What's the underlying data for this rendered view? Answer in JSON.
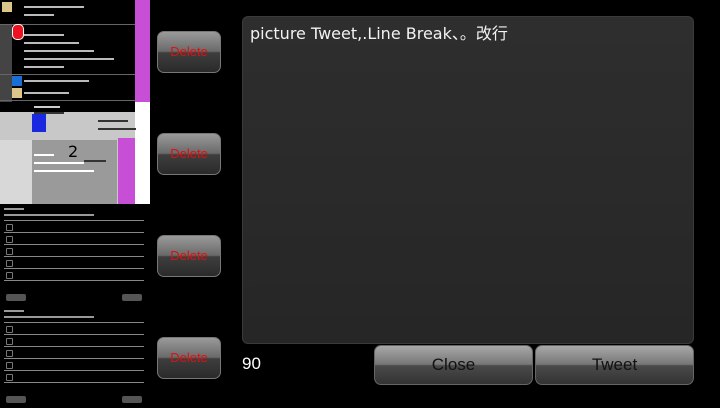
{
  "tweet_text": "picture Tweet,.Line Break、。改行",
  "char_count": "90",
  "buttons": {
    "close": "Close",
    "tweet": "Tweet"
  },
  "delete_label": "Delete",
  "thumbnails": {
    "second_page_number": "2"
  },
  "colors": {
    "delete_text": "#dd1111",
    "accent_magenta": "#c64fd6",
    "textarea_bg": "#2a2a2a"
  }
}
